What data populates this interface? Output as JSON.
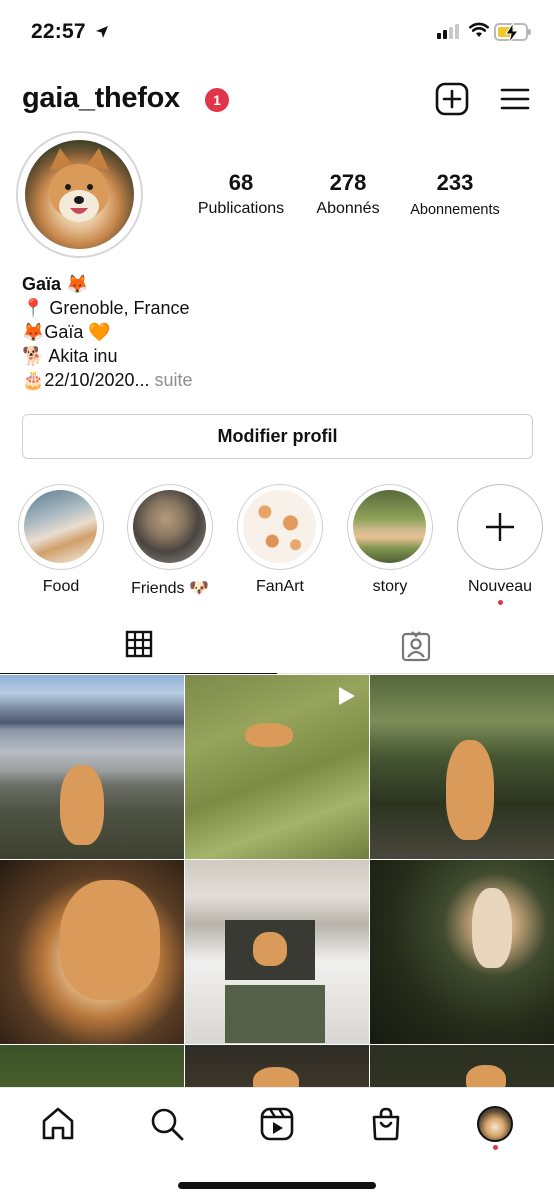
{
  "status_bar": {
    "time": "22:57",
    "icons": [
      "location-arrow-icon",
      "cellular-signal-icon",
      "wifi-icon",
      "battery-charging-icon"
    ],
    "signal_bars_active": 2,
    "signal_bars_total": 4,
    "battery_level": 0.5,
    "battery_color": "#f2c92c"
  },
  "header": {
    "username": "gaia_thefox",
    "notification_count": "1",
    "badge_color": "#e0354a",
    "icons": [
      "new-post-icon",
      "menu-icon"
    ]
  },
  "profile": {
    "avatar_icon": "profile-photo",
    "stats": [
      {
        "value": "68",
        "label": "Publications"
      },
      {
        "value": "278",
        "label": "Abonnés"
      },
      {
        "value": "233",
        "label": "Abonnements"
      }
    ],
    "bio": {
      "name": "Gaïa 🦊",
      "line1": "📍 Grenoble, France",
      "line2": "🦊Gaïa 🧡",
      "line3": "🐕 Akita inu",
      "line4": "🎂22/10/2020...",
      "more": " suite"
    },
    "edit_button": "Modifier profil"
  },
  "highlights": [
    {
      "label": "Food"
    },
    {
      "label": "Friends 🐶"
    },
    {
      "label": "FanArt"
    },
    {
      "label": "story"
    },
    {
      "label": "Nouveau"
    }
  ],
  "tabs": {
    "icons": [
      "grid-icon",
      "tagged-icon"
    ],
    "active": "grid"
  },
  "grid": {
    "post_count_visible": 9,
    "video_post_indices": [
      1
    ]
  },
  "bottom_nav": {
    "icons": [
      "home-icon",
      "search-icon",
      "reels-icon",
      "shop-icon",
      "profile-avatar-icon"
    ],
    "active": "profile"
  }
}
